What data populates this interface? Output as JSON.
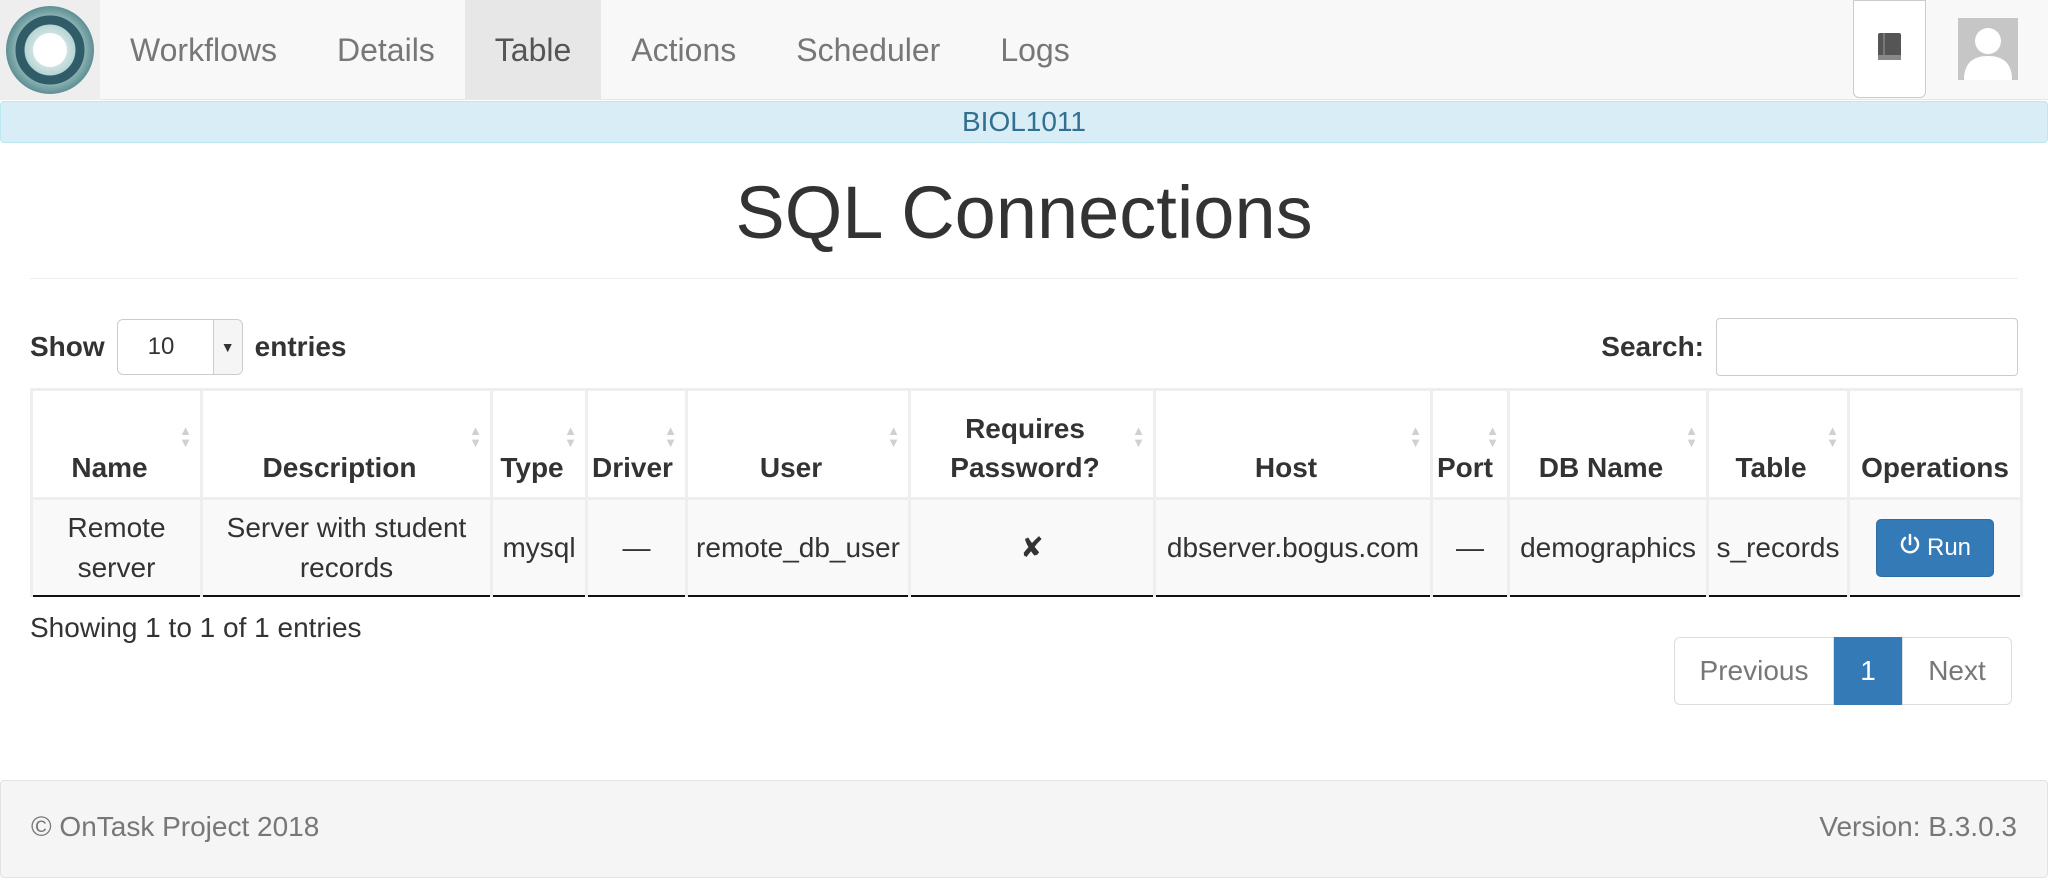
{
  "nav": {
    "items": [
      {
        "label": "Workflows",
        "active": false
      },
      {
        "label": "Details",
        "active": false
      },
      {
        "label": "Table",
        "active": true
      },
      {
        "label": "Actions",
        "active": false
      },
      {
        "label": "Scheduler",
        "active": false
      },
      {
        "label": "Logs",
        "active": false
      }
    ],
    "logo_icon": "ontask-logo-icon",
    "docs_icon": "book-icon",
    "avatar_icon": "user-avatar-icon"
  },
  "workflow_name": "BIOL1011",
  "page_title": "SQL Connections",
  "table_controls": {
    "show_label": "Show",
    "entries_label": "entries",
    "page_length": "10",
    "search_label": "Search:",
    "search_value": ""
  },
  "table": {
    "columns": [
      {
        "label": "Name",
        "sortable": true
      },
      {
        "label": "Description",
        "sortable": true
      },
      {
        "label": "Type",
        "sortable": true
      },
      {
        "label": "Driver",
        "sortable": true
      },
      {
        "label": "User",
        "sortable": true
      },
      {
        "label": "Requires Password?",
        "sortable": true
      },
      {
        "label": "Host",
        "sortable": true
      },
      {
        "label": "Port",
        "sortable": true
      },
      {
        "label": "DB Name",
        "sortable": true
      },
      {
        "label": "Table",
        "sortable": true
      },
      {
        "label": "Operations",
        "sortable": false
      }
    ],
    "rows": [
      {
        "name": "Remote server",
        "description": "Server with student records",
        "type": "mysql",
        "driver": "—",
        "user": "remote_db_user",
        "requires_password": "✘",
        "host": "dbserver.bogus.com",
        "port": "—",
        "db_name": "demographics",
        "table": "s_records",
        "run_label": "Run",
        "run_icon": "power-icon"
      }
    ]
  },
  "table_info": "Showing 1 to 1 of 1 entries",
  "pagination": {
    "previous": "Previous",
    "current": "1",
    "next": "Next"
  },
  "footer": {
    "copyright": "© OnTask Project 2018",
    "version": "Version: B.3.0.3"
  },
  "colors": {
    "primary": "#337ab7",
    "banner_bg": "#d9edf7",
    "banner_text": "#31708f",
    "navbar_bg": "#f8f8f8"
  }
}
